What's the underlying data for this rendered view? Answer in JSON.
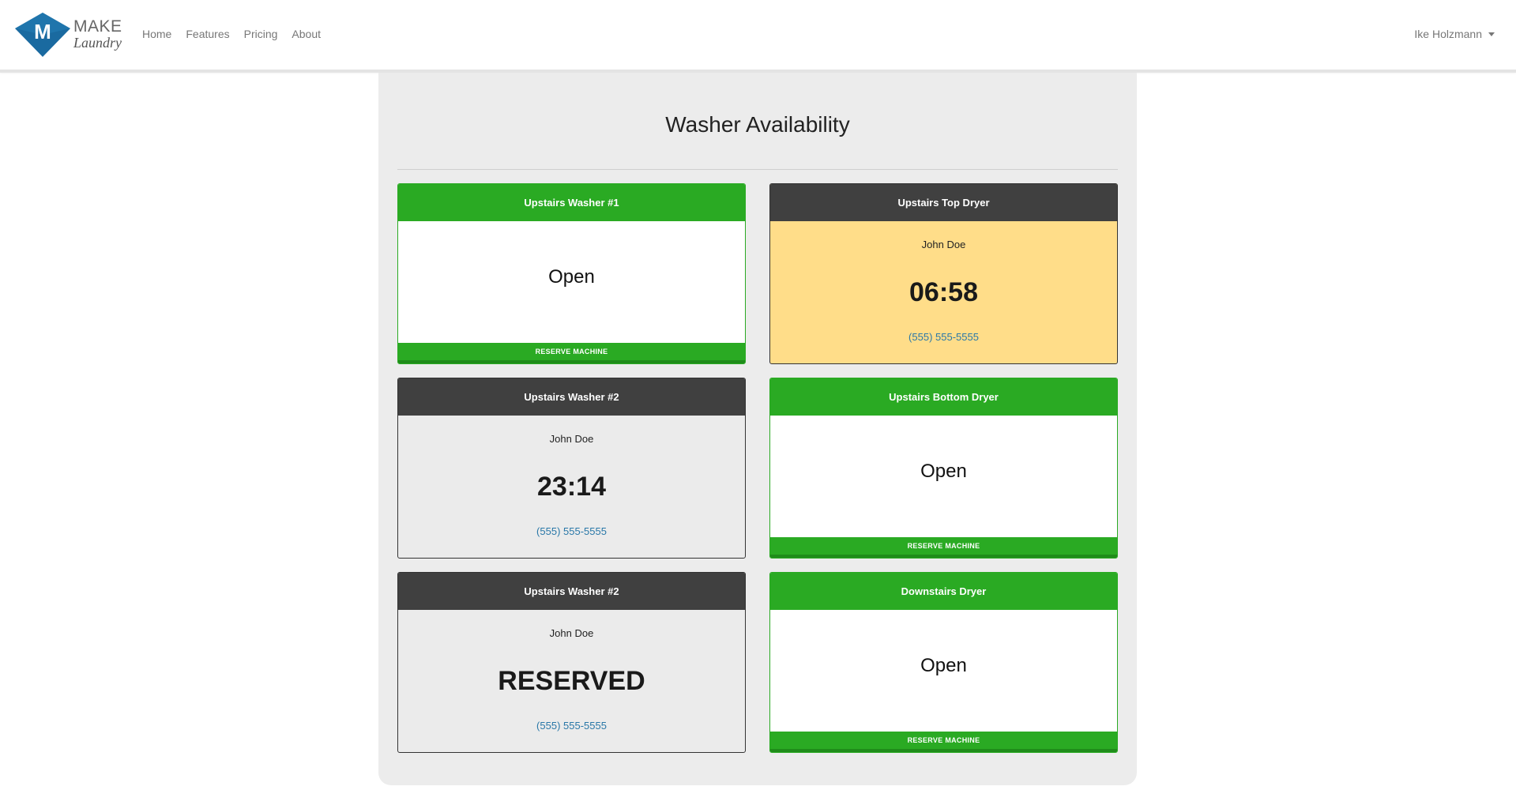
{
  "brand": {
    "make": "MAKE",
    "laundry": "Laundry",
    "logo_letter": "M",
    "logo_color": "#1a6aa0"
  },
  "nav": {
    "links": [
      "Home",
      "Features",
      "Pricing",
      "About"
    ],
    "user": "Ike Holzmann"
  },
  "page": {
    "title": "Washer Availability"
  },
  "colors": {
    "open_green": "#2aaa23",
    "busy_header": "#404040",
    "in_use_highlight": "#ffdd89",
    "phone_link": "#2a78a8"
  },
  "machines": [
    {
      "name": "Upstairs Washer #1",
      "status": "Open",
      "action": "RESERVE MACHINE"
    },
    {
      "name": "Upstairs Top Dryer",
      "user": "John Doe",
      "timer": "06:58",
      "phone": "(555) 555-5555"
    },
    {
      "name": "Upstairs Washer #2",
      "user": "John Doe",
      "timer": "23:14",
      "phone": "(555) 555-5555"
    },
    {
      "name": "Upstairs Bottom Dryer",
      "status": "Open",
      "action": "RESERVE MACHINE"
    },
    {
      "name": "Upstairs Washer #2",
      "user": "John Doe",
      "timer": "RESERVED",
      "phone": "(555) 555-5555"
    },
    {
      "name": "Downstairs Dryer",
      "status": "Open",
      "action": "RESERVE MACHINE"
    }
  ]
}
